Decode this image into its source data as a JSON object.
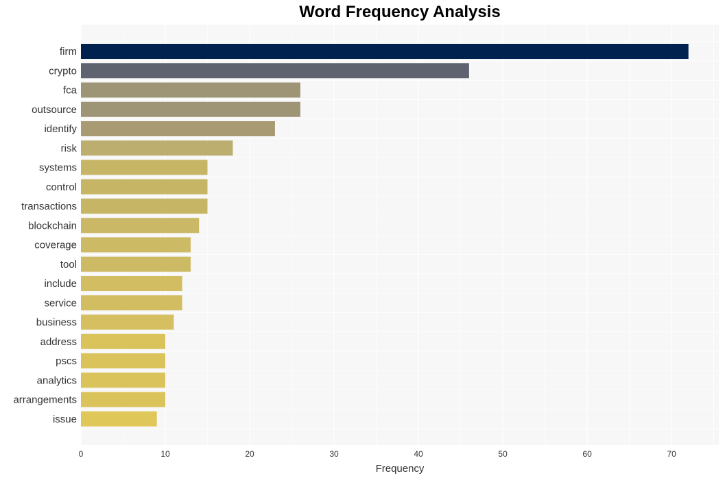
{
  "chart_data": {
    "type": "bar",
    "orientation": "horizontal",
    "title": "Word Frequency Analysis",
    "xlabel": "Frequency",
    "ylabel": "",
    "xlim": [
      0,
      75.6
    ],
    "xticks": [
      0,
      10,
      20,
      30,
      40,
      50,
      60,
      70
    ],
    "grid": true,
    "categories": [
      "firm",
      "crypto",
      "fca",
      "outsource",
      "identify",
      "risk",
      "systems",
      "control",
      "transactions",
      "blockchain",
      "coverage",
      "tool",
      "include",
      "service",
      "business",
      "address",
      "pscs",
      "analytics",
      "arrangements",
      "issue"
    ],
    "values": [
      72,
      46,
      26,
      26,
      23,
      18,
      15,
      15,
      15,
      14,
      13,
      13,
      12,
      12,
      11,
      10,
      10,
      10,
      10,
      9
    ],
    "colors": [
      "#00224e",
      "#5f6370",
      "#9e9476",
      "#9e9476",
      "#a89b74",
      "#bcae6e",
      "#c7b566",
      "#c7b566",
      "#c7b566",
      "#cab866",
      "#cdba64",
      "#cdba64",
      "#d2bd62",
      "#d2bd62",
      "#d5bf60",
      "#dbc35c",
      "#dbc35c",
      "#dbc35c",
      "#dbc35c",
      "#dfc75a"
    ]
  }
}
